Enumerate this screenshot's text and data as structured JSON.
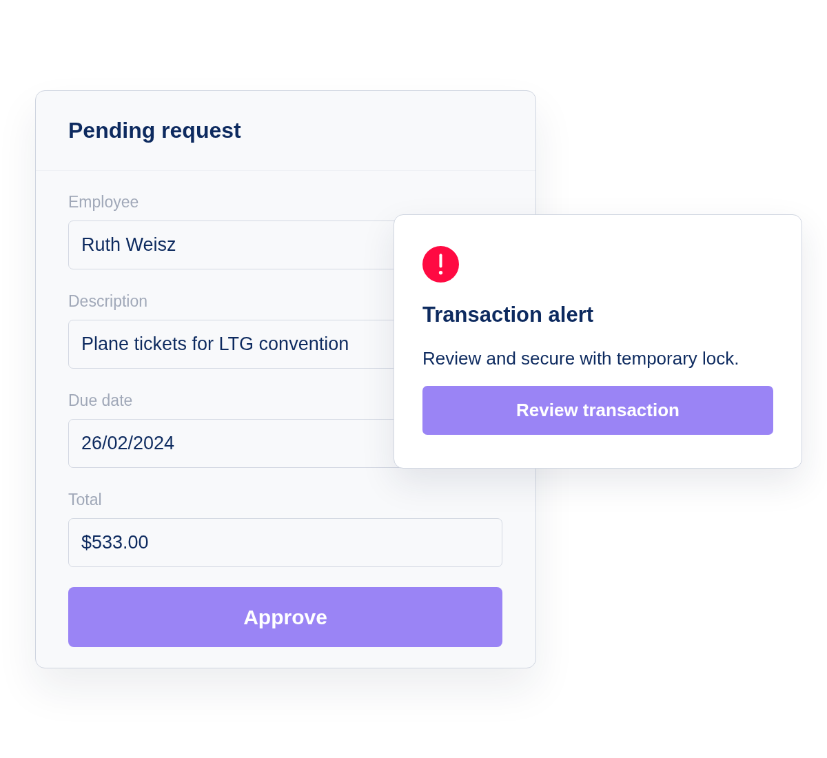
{
  "request_card": {
    "title": "Pending request",
    "fields": [
      {
        "label": "Employee",
        "value": "Ruth Weisz"
      },
      {
        "label": "Description",
        "value": "Plane tickets for LTG convention"
      },
      {
        "label": "Due date",
        "value": "26/02/2024"
      },
      {
        "label": "Total",
        "value": "$533.00"
      }
    ],
    "approve_button": "Approve"
  },
  "alert_card": {
    "title": "Transaction alert",
    "message": "Review and secure with temporary lock.",
    "button": "Review transaction"
  }
}
